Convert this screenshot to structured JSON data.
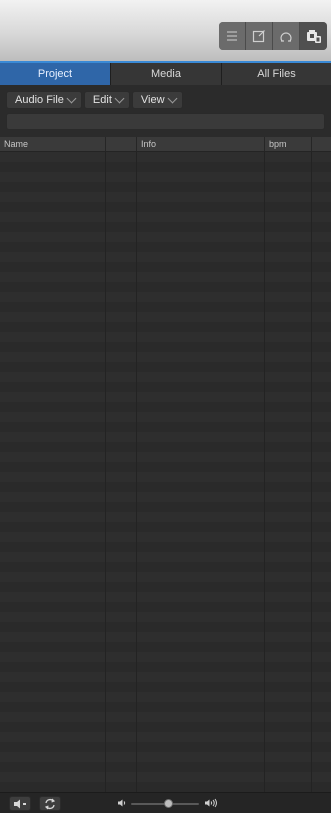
{
  "toolbar": {
    "icons": [
      "list-icon",
      "note-icon",
      "loops-icon",
      "browser-icon"
    ]
  },
  "tabs": [
    {
      "label": "Project"
    },
    {
      "label": "Media"
    },
    {
      "label": "All Files"
    }
  ],
  "menus": [
    {
      "label": "Audio File"
    },
    {
      "label": "Edit"
    },
    {
      "label": "View"
    }
  ],
  "search": {
    "value": ""
  },
  "table": {
    "columns": [
      "Name",
      "",
      "Info",
      "bpm"
    ],
    "rows": []
  },
  "footer": {
    "volume_level": 0.55,
    "icons": [
      "speaker-out-icon",
      "loop-icon",
      "volume-low-icon",
      "volume-high-icon"
    ]
  },
  "colors": {
    "accent": "#2f66a8",
    "tab_highlight": "#3a8ad6"
  }
}
